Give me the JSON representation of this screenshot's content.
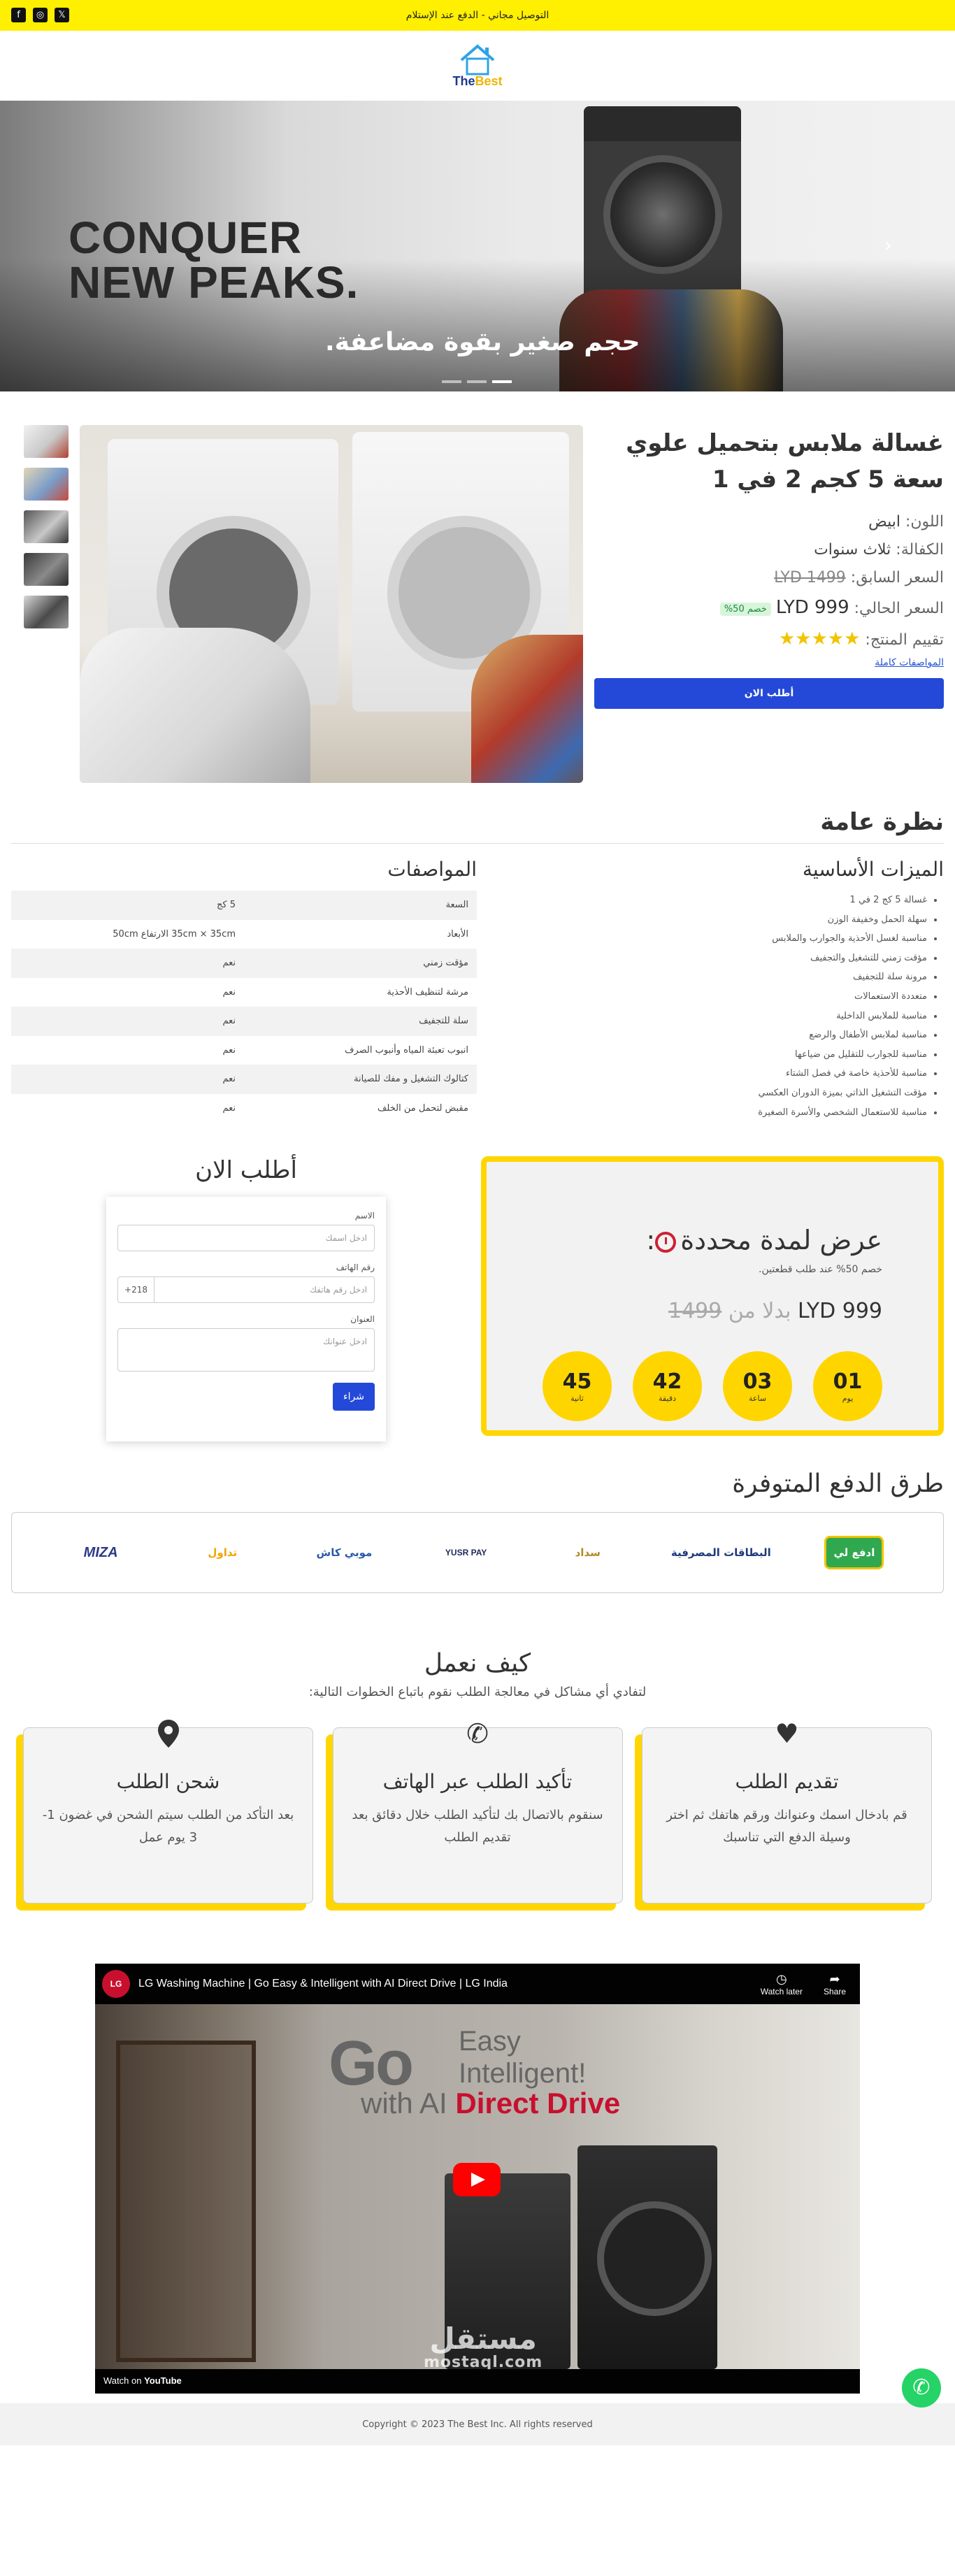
{
  "topbar": {
    "message": "التوصيل مجاني - الدفع عند الإستلام",
    "socials": [
      "f",
      "◎",
      "𝕏"
    ]
  },
  "logo": {
    "text_main": "The",
    "text_accent": "Best"
  },
  "hero": {
    "headline_line1": "CONQUER",
    "headline_line2": "NEW PEAKS.",
    "subtitle": "حجم صغير بقوة مضاعفة.",
    "next_arrow": "›"
  },
  "product": {
    "title": "غسالة ملابس بتحميل علوي سعة 5 كجم 2 في 1",
    "color_label": "اللون:",
    "color_value": "ابيض",
    "warranty_label": "الكفالة:",
    "warranty_value": "ثلاث سنوات",
    "old_price_label": "السعر السابق:",
    "old_price": "LYD 1499",
    "price_label": "السعر الحالي:",
    "price": "LYD 999",
    "discount": "خصم 50%",
    "rating_label": "تقييم المنتج:",
    "rating": 5,
    "stars": "★★★★★",
    "specs_link": "المواصفات كاملة",
    "order_button": "أطلب الان"
  },
  "overview": {
    "title": "نظرة عامة",
    "features_title": "الميزات الأساسية",
    "features": [
      "غسالة 5 كج 2 في 1",
      "سهلة الحمل وخفيفة الوزن",
      "مناسبة لغسل الأحذية والجوارب والملابس",
      "مؤقت زمني للتشغيل والتجفيف",
      "مرونة سلة للتجفيف",
      "متعددة الاستعمالات",
      "مناسبة للملابس الداخلية",
      "مناسبة لملابس الأطفال والرضع",
      "مناسبة للجوارب للتقليل من ضياعها",
      "مناسبة للأحذية خاصة في فصل الشتاء",
      "مؤقت التشغيل الذاتي بميزة الدوران العكسي",
      "مناسبة للاستعمال الشخصي والأسرة الصغيرة"
    ],
    "specs_title": "المواصفات",
    "specs": [
      [
        "السعة",
        "5 كج"
      ],
      [
        "الأبعاد",
        "35cm × 35cm الارتفاع 50cm"
      ],
      [
        "مؤقت زمني",
        "نعم"
      ],
      [
        "مرشة لتنظيف الأحذية",
        "نعم"
      ],
      [
        "سلة للتجفيف",
        "نعم"
      ],
      [
        "انبوب تعبئة المياه وأنبوب الصرف",
        "نعم"
      ],
      [
        "كتالوك التشغيل و مفك للصيانة",
        "نعم"
      ],
      [
        "مقبض لتحمل من الخلف",
        "نعم"
      ]
    ]
  },
  "offer": {
    "title": "عرض لمدة محددة",
    "title_suffix": ":",
    "note": "خصم 50% عند طلب قطعتين.",
    "price_new": "LYD 999",
    "price_mid": "بدلا من",
    "price_old": "1499",
    "timer": [
      {
        "value": "01",
        "unit": "يوم"
      },
      {
        "value": "03",
        "unit": "ساعة"
      },
      {
        "value": "42",
        "unit": "دقيقة"
      },
      {
        "value": "45",
        "unit": "ثانية"
      }
    ]
  },
  "order_form": {
    "title": "أطلب الان",
    "name_label": "الاسم",
    "name_placeholder": "ادخل اسمك",
    "phone_label": "رقم الهاتف",
    "phone_placeholder": "ادخل رقم هاتفك",
    "phone_code": "+218",
    "address_label": "العنوان",
    "address_placeholder": "ادخل عنوانك",
    "submit": "شراء"
  },
  "payment": {
    "title": "طرق الدفع المتوفرة",
    "methods": [
      "ادفع لي",
      "البطاقات المصرفية",
      "سداد",
      "YUSR PAY",
      "موبي كاش",
      "تداول",
      "MIZA"
    ]
  },
  "how": {
    "title": "كيف نعمل",
    "lead": "لتفادي أي مشاكل في معالجة الطلب نقوم باتباع الخطوات التالية:",
    "steps": [
      {
        "icon": "♥",
        "title": "تقديم الطلب",
        "text": "قم بادخال اسمك وعنوانك ورقم هاتفك ثم اختر وسيلة الدفع التي تناسبك"
      },
      {
        "icon": "✆",
        "title": "تأكيد الطلب عبر الهاتف",
        "text": "سنقوم بالاتصال بك لتأكيد الطلب خلال دقائق بعد تقديم الطلب"
      },
      {
        "icon": "⬤",
        "title": "شحن الطلب",
        "text": "بعد التأكد من الطلب سيتم الشحن في غضون 1-3 يوم عمل"
      }
    ]
  },
  "video": {
    "channel_badge": "LG",
    "title": "LG Washing Machine | Go Easy & Intelligent with AI Direct Drive | LG India",
    "watch_later": "Watch later",
    "share": "Share",
    "headline_go": "Go",
    "headline_easy": "Easy",
    "headline_intelligent": "Intelligent!",
    "headline_with": "with AI",
    "headline_dd": "Direct Drive",
    "watch_on": "Watch on",
    "youtube": "YouTube",
    "watermark": "مستقل",
    "watermark_url": "mostaql.com"
  },
  "footer": {
    "copyright": "Copyright © 2023 The Best Inc. All rights reserved"
  },
  "colors": {
    "accent_yellow": "#ffd600",
    "primary_blue": "#2449d8"
  }
}
